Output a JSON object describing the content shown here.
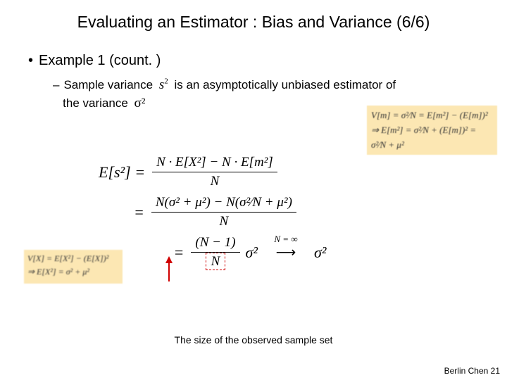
{
  "title": "Evaluating an Estimator : Bias and Variance (6/6)",
  "bullet": "Example 1 (count. )",
  "sub_bullet_1": "Sample variance",
  "sub_bullet_2": "is an asymptotically unbiased estimator of",
  "sub_bullet_3": "the variance",
  "inline_s2": "s",
  "inline_s2_sup": "2",
  "inline_sigma2": "σ²",
  "eq1_lhs": "E[s²] =",
  "eq1_num": "N · E[X²] − N · E[m²]",
  "eq1_den": "N",
  "eq2_eq": "=",
  "eq2_num": "N(σ² + μ²) − N(σ²⁄N + μ²)",
  "eq2_den": "N",
  "eq3_eq": "=",
  "eq3_num": "(N − 1)",
  "eq3_den": "N",
  "eq3_right": "σ²",
  "eq3_limit_top": "N = ∞",
  "eq3_limit_arrow": "⟶",
  "eq3_result": "σ²",
  "side_right_l1": "V[m] = σ²⁄N = E[m²] − (E[m])²",
  "side_right_l2": "⇒ E[m²] = σ²⁄N + (E[m])² = σ²⁄N + μ²",
  "side_left_l1": "V[X] = E[X²] − (E[X])²",
  "side_left_l2": "⇒ E[X²] = σ² + μ²",
  "caption": "The size of the observed sample set",
  "footer": "Berlin Chen 21"
}
